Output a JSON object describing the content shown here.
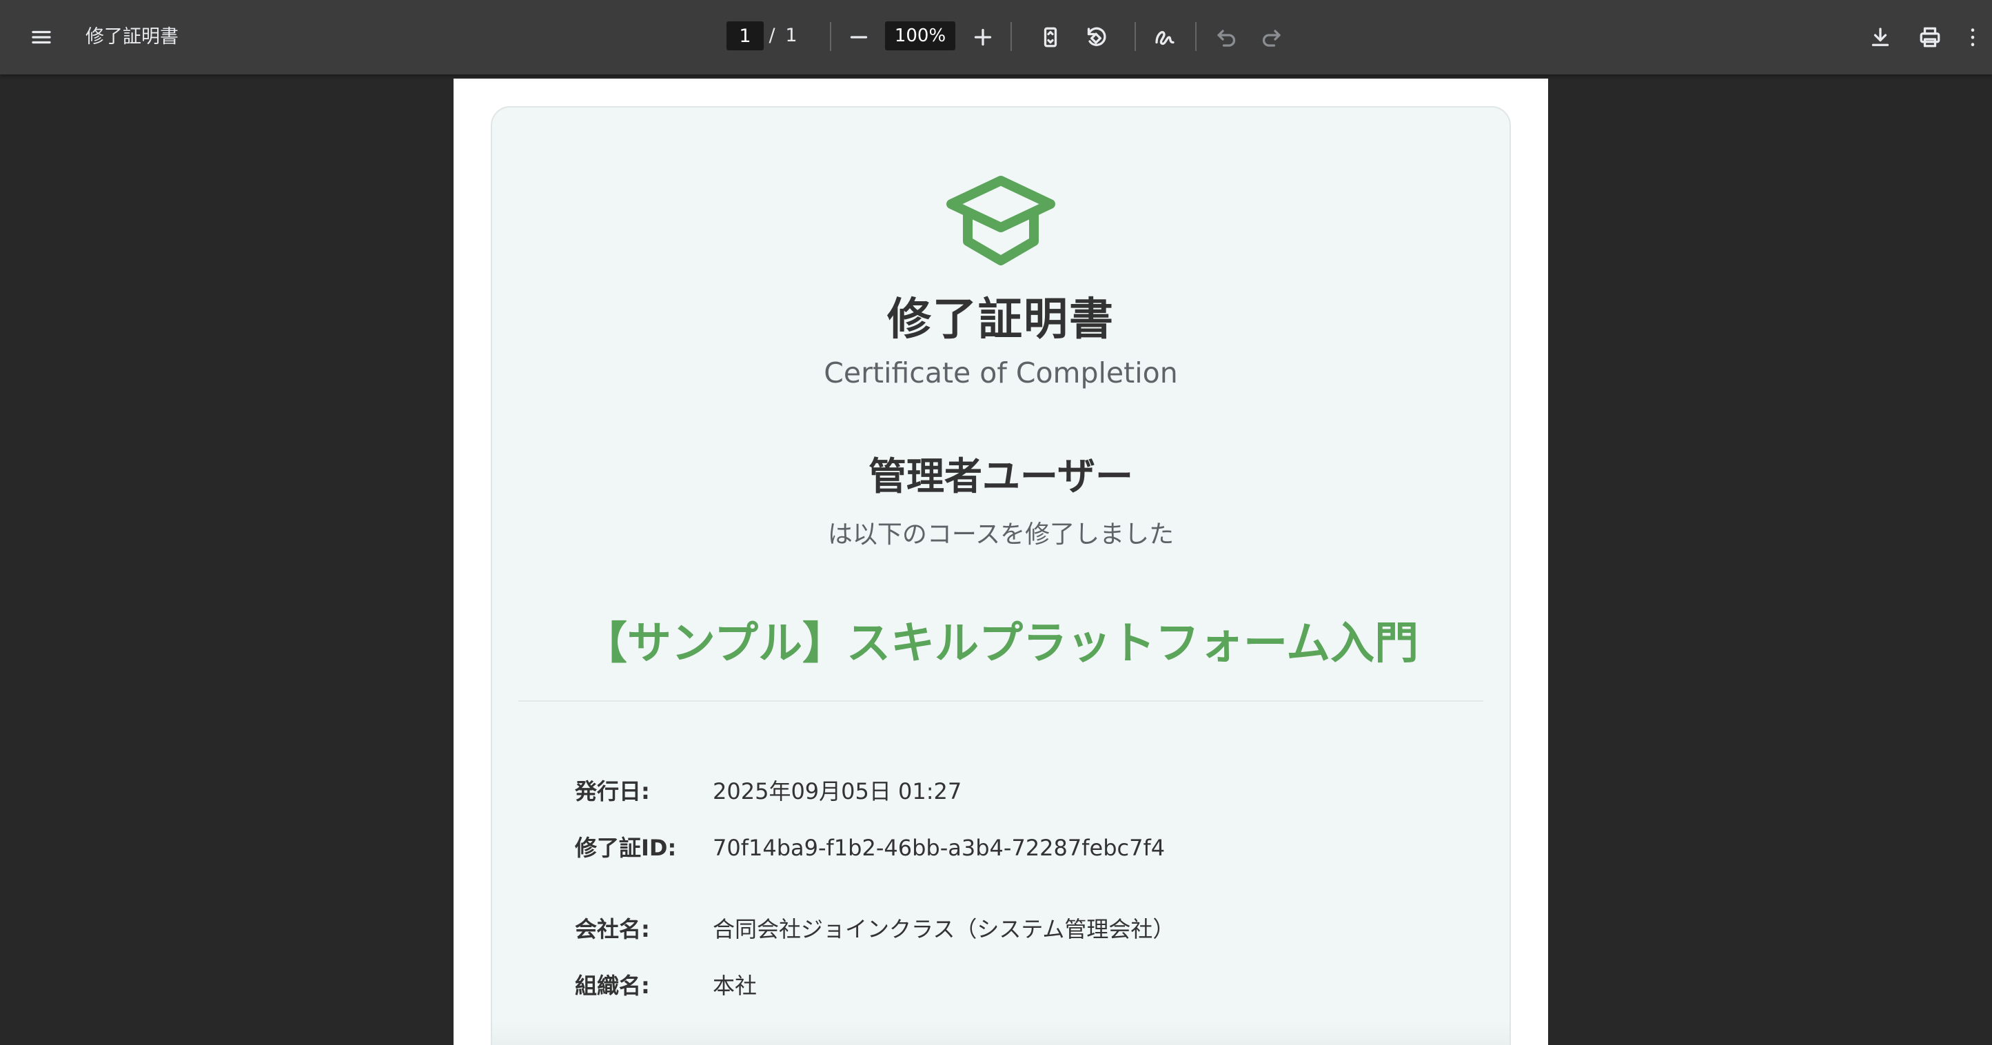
{
  "toolbar": {
    "title": "修了証明書",
    "page_current": "1",
    "page_separator": "/",
    "page_total": "1",
    "zoom": "100%",
    "icons": {
      "menu": "menu-icon",
      "zoom_out": "minus-icon",
      "zoom_in": "plus-icon",
      "fit_page": "fit-page-icon",
      "rotate": "rotate-icon",
      "annotate": "pen-icon",
      "undo": "undo-icon",
      "redo": "redo-icon",
      "download": "download-icon",
      "print": "print-icon",
      "more": "more-vertical-icon"
    }
  },
  "certificate": {
    "icon": "graduation-cap-icon",
    "title": "修了証明書",
    "subtitle": "Certificate of Completion",
    "user_name": "管理者ユーザー",
    "completed_text": "は以下のコースを修了しました",
    "course_name": "【サンプル】スキルプラットフォーム入門",
    "fields": {
      "issue_date_label": "発行日:",
      "issue_date_value": "2025年09月05日 01:27",
      "cert_id_label": "修了証ID:",
      "cert_id_value": "70f14ba9-f1b2-46bb-a3b4-72287febc7f4",
      "company_label": "会社名:",
      "company_value": "合同会社ジョインクラス（システム管理会社）",
      "org_label": "組織名:",
      "org_value": "本社"
    }
  },
  "colors": {
    "toolbar_bg": "#3c3c3c",
    "viewer_bg": "#282828",
    "card_bg": "#f1f7f6",
    "accent_green": "#5ba55b",
    "text_dark": "#333333",
    "text_muted": "#5f6368"
  }
}
